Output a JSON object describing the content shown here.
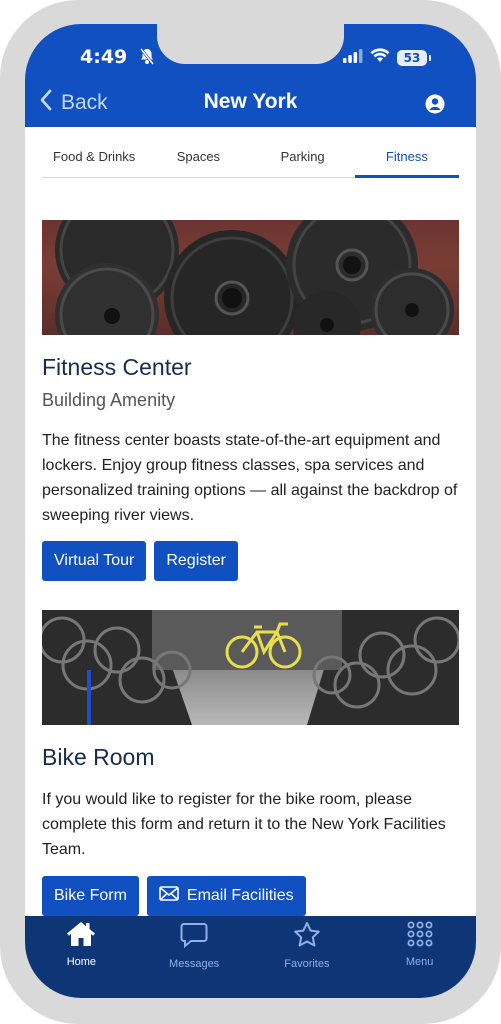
{
  "status": {
    "time": "4:49",
    "battery": "53"
  },
  "header": {
    "back_label": "Back",
    "title": "New York"
  },
  "tabs": [
    {
      "label": "Food & Drinks",
      "active": false
    },
    {
      "label": "Spaces",
      "active": false
    },
    {
      "label": "Parking",
      "active": false
    },
    {
      "label": "Fitness",
      "active": true
    }
  ],
  "cards": [
    {
      "title": "Fitness Center",
      "subtitle": "Building Amenity",
      "description": "The fitness center boasts state-of-the-art equipment and lockers. Enjoy group fitness classes, spa services and personalized training options — all against the backdrop of sweeping river views.",
      "buttons": [
        "Virtual Tour",
        "Register"
      ]
    },
    {
      "title": "Bike Room",
      "description": "If you would like to register for the bike room, please complete this form and return it to the New York Facilities Team.",
      "buttons": [
        "Bike Form",
        "Email Facilities"
      ]
    }
  ],
  "nav": [
    {
      "label": "Home",
      "icon": "home-icon",
      "active": true
    },
    {
      "label": "Messages",
      "icon": "chat-icon",
      "active": false
    },
    {
      "label": "Favorites",
      "icon": "star-icon",
      "active": false
    },
    {
      "label": "Menu",
      "icon": "grid-icon",
      "active": false
    }
  ],
  "colors": {
    "brand": "#1050c0",
    "nav_bg": "#0e3575"
  }
}
